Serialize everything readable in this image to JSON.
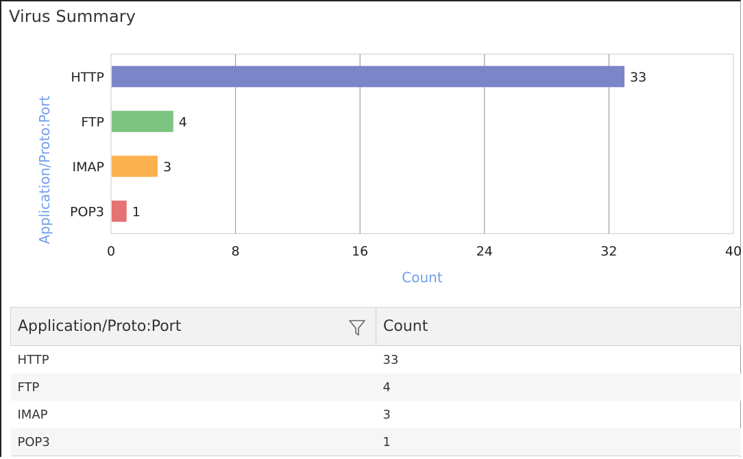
{
  "widget": {
    "title": "Virus Summary"
  },
  "chart_data": {
    "type": "bar",
    "orientation": "horizontal",
    "categories": [
      "HTTP",
      "FTP",
      "IMAP",
      "POP3"
    ],
    "values": [
      33,
      4,
      3,
      1
    ],
    "colors": [
      "#7b86c9",
      "#7cc47f",
      "#fcb150",
      "#e47373"
    ],
    "xlabel": "Count",
    "ylabel": "Application/Proto:Port",
    "xlim": [
      0,
      40
    ],
    "xticks": [
      0,
      8,
      16,
      24,
      32,
      40
    ],
    "grid": true,
    "data_labels": true,
    "axis_label_color": "#6f9fea"
  },
  "table": {
    "columns": [
      "Application/Proto:Port",
      "Count"
    ],
    "rows": [
      [
        "HTTP",
        "33"
      ],
      [
        "FTP",
        "4"
      ],
      [
        "IMAP",
        "3"
      ],
      [
        "POP3",
        "1"
      ]
    ]
  }
}
